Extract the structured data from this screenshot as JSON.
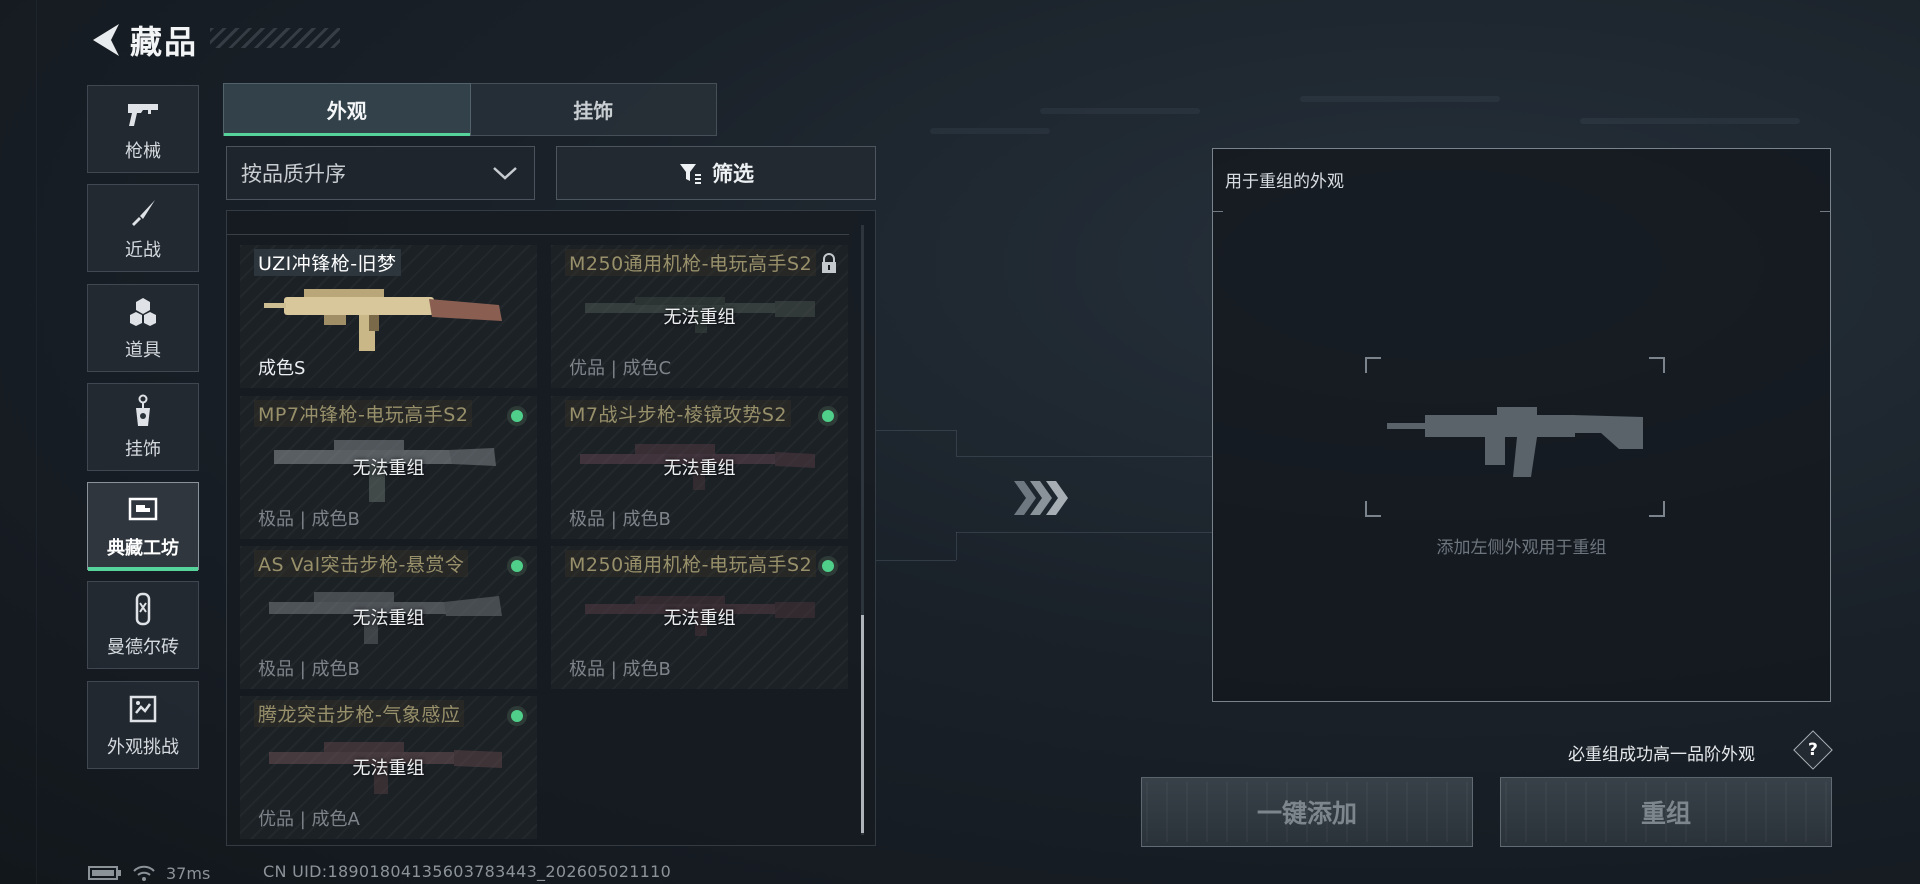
{
  "header": {
    "title": "藏品"
  },
  "sidebar": {
    "items": [
      {
        "label": "枪械",
        "icon": "pistol-icon"
      },
      {
        "label": "近战",
        "icon": "knife-icon"
      },
      {
        "label": "道具",
        "icon": "grenade-icon"
      },
      {
        "label": "挂饰",
        "icon": "charm-icon"
      },
      {
        "label": "典藏工坊",
        "icon": "workshop-icon",
        "active": true
      },
      {
        "label": "曼德尔砖",
        "icon": "brick-icon"
      },
      {
        "label": "外观挑战",
        "icon": "challenge-icon"
      }
    ]
  },
  "tabs": [
    {
      "label": "外观",
      "active": true
    },
    {
      "label": "挂饰",
      "active": false
    }
  ],
  "sort": {
    "value": "按品质升序"
  },
  "filter": {
    "label": "筛选"
  },
  "cards": [
    {
      "name": "UZI冲锋枪-旧梦",
      "quality": "成色S",
      "status": "available",
      "overlay": ""
    },
    {
      "name": "M250通用机枪-电玩高手S2",
      "quality": "优品 | 成色C",
      "status": "locked",
      "overlay": "无法重组"
    },
    {
      "name": "MP7冲锋枪-电玩高手S2",
      "quality": "极品 | 成色B",
      "status": "equipped",
      "overlay": "无法重组"
    },
    {
      "name": "M7战斗步枪-棱镜攻势S2",
      "quality": "极品 | 成色B",
      "status": "equipped",
      "overlay": "无法重组"
    },
    {
      "name": "AS Val突击步枪-悬赏令",
      "quality": "极品 | 成色B",
      "status": "equipped",
      "overlay": "无法重组"
    },
    {
      "name": "M250通用机枪-电玩高手S2",
      "quality": "极品 | 成色B",
      "status": "equipped",
      "overlay": "无法重组"
    },
    {
      "name": "腾龙突击步枪-气象感应",
      "quality": "优品 | 成色A",
      "status": "equipped",
      "overlay": "无法重组"
    }
  ],
  "panel": {
    "title": "用于重组的外观",
    "placeholder": "添加左侧外观用于重组"
  },
  "guarantee": {
    "text": "必重组成功高一品阶外观",
    "help": "?"
  },
  "buttons": {
    "one_click_add": "一键添加",
    "recombine": "重组"
  },
  "status": {
    "ping": "37ms",
    "uid": "CN UID:18901804135603783443_202605021110"
  },
  "colors": {
    "accent_green": "#56d39a",
    "status_dot": "#4fcf8a",
    "gold_gun": "#d8c79a"
  }
}
